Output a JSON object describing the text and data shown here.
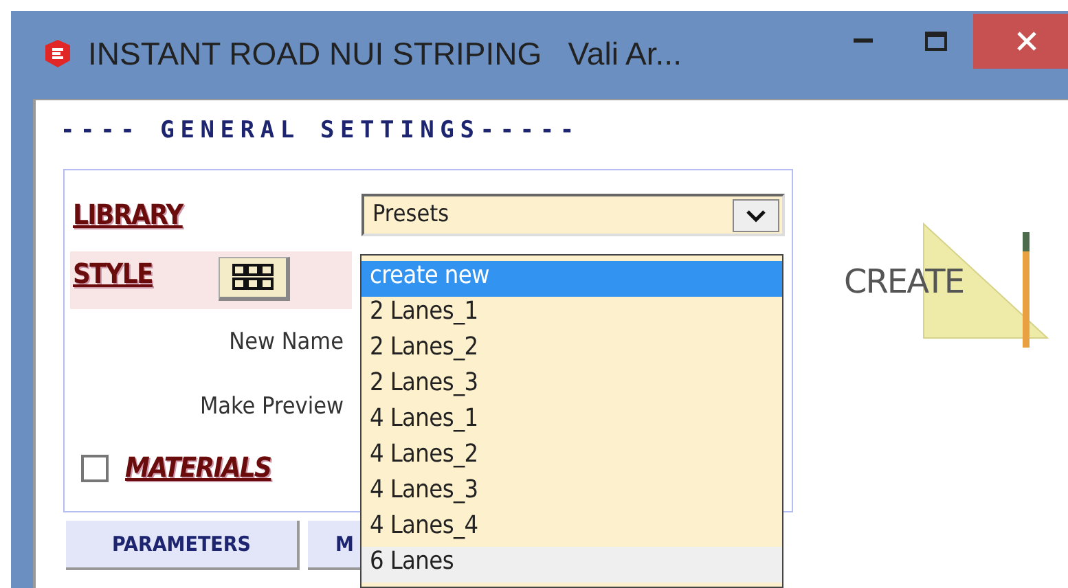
{
  "window": {
    "title": "INSTANT ROAD NUI STRIPING   Vali Ar..."
  },
  "heading": "---- GENERAL SETTINGS-----",
  "library": {
    "label": "LIBRARY",
    "value": "Presets"
  },
  "style": {
    "label": "STYLE"
  },
  "fields": [
    {
      "label": "New Name"
    },
    {
      "label": "Make Preview"
    }
  ],
  "materials": {
    "label": "MATERIALS",
    "checked": false
  },
  "tabs": [
    {
      "label": "PARAMETERS",
      "selected": false
    },
    {
      "label": "M",
      "selected": false
    }
  ],
  "dropdown_items": [
    {
      "label": "create new",
      "selected": true,
      "hovered": false
    },
    {
      "label": "2 Lanes_1",
      "selected": false,
      "hovered": false
    },
    {
      "label": "2 Lanes_2",
      "selected": false,
      "hovered": false
    },
    {
      "label": "2 Lanes_3",
      "selected": false,
      "hovered": false
    },
    {
      "label": "4 Lanes_1",
      "selected": false,
      "hovered": false
    },
    {
      "label": "4 Lanes_2",
      "selected": false,
      "hovered": false
    },
    {
      "label": "4 Lanes_3",
      "selected": false,
      "hovered": false
    },
    {
      "label": "4 Lanes_4",
      "selected": false,
      "hovered": false
    },
    {
      "label": "6 Lanes",
      "selected": false,
      "hovered": true
    }
  ],
  "logo": {
    "text": "CREATE"
  }
}
